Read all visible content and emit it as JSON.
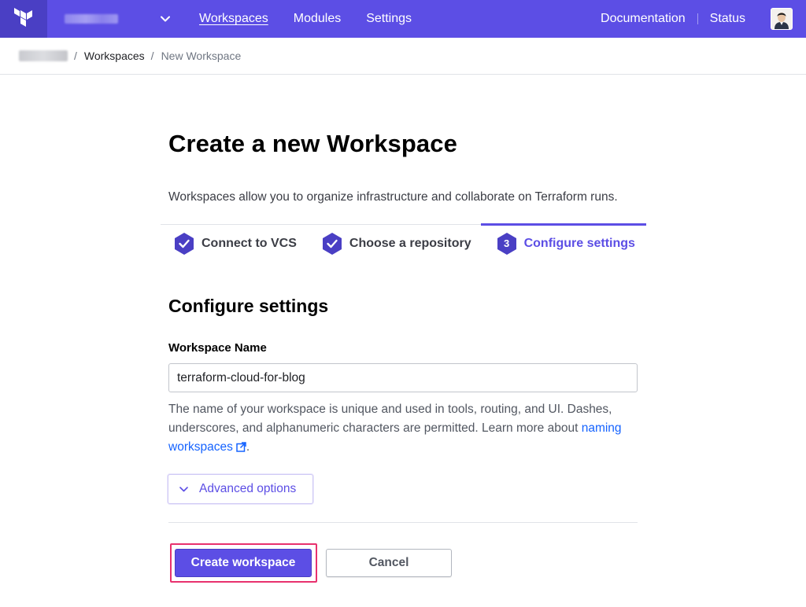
{
  "nav": {
    "logo": "terraform-logo",
    "org_name_redacted": true,
    "links": [
      "Workspaces",
      "Modules",
      "Settings"
    ],
    "active_link": "Workspaces",
    "right_links": [
      "Documentation",
      "Status"
    ]
  },
  "breadcrumb": {
    "org_redacted": true,
    "separator": "/",
    "workspaces": "Workspaces",
    "current": "New Workspace"
  },
  "page": {
    "title": "Create a new Workspace",
    "description": "Workspaces allow you to organize infrastructure and collaborate on Terraform runs."
  },
  "steps": [
    {
      "label": "Connect to VCS",
      "state": "done",
      "icon": "check-icon"
    },
    {
      "label": "Choose a repository",
      "state": "done",
      "icon": "check-icon"
    },
    {
      "label": "Configure settings",
      "state": "current",
      "number": "3"
    }
  ],
  "form": {
    "section_title": "Configure settings",
    "workspace_name_label": "Workspace Name",
    "workspace_name_value": "terraform-cloud-for-blog",
    "help_text": "The name of your workspace is unique and used in tools, routing, and UI. Dashes, underscores, and alphanumeric characters are permitted. Learn more about ",
    "help_link": "naming workspaces",
    "help_end": ".",
    "advanced_options": "Advanced options"
  },
  "actions": {
    "create": "Create workspace",
    "cancel": "Cancel"
  },
  "colors": {
    "brand": "#5c4ee5",
    "brand_dark": "#4a3fc4",
    "link": "#1563ff",
    "highlight": "#e8316e"
  }
}
